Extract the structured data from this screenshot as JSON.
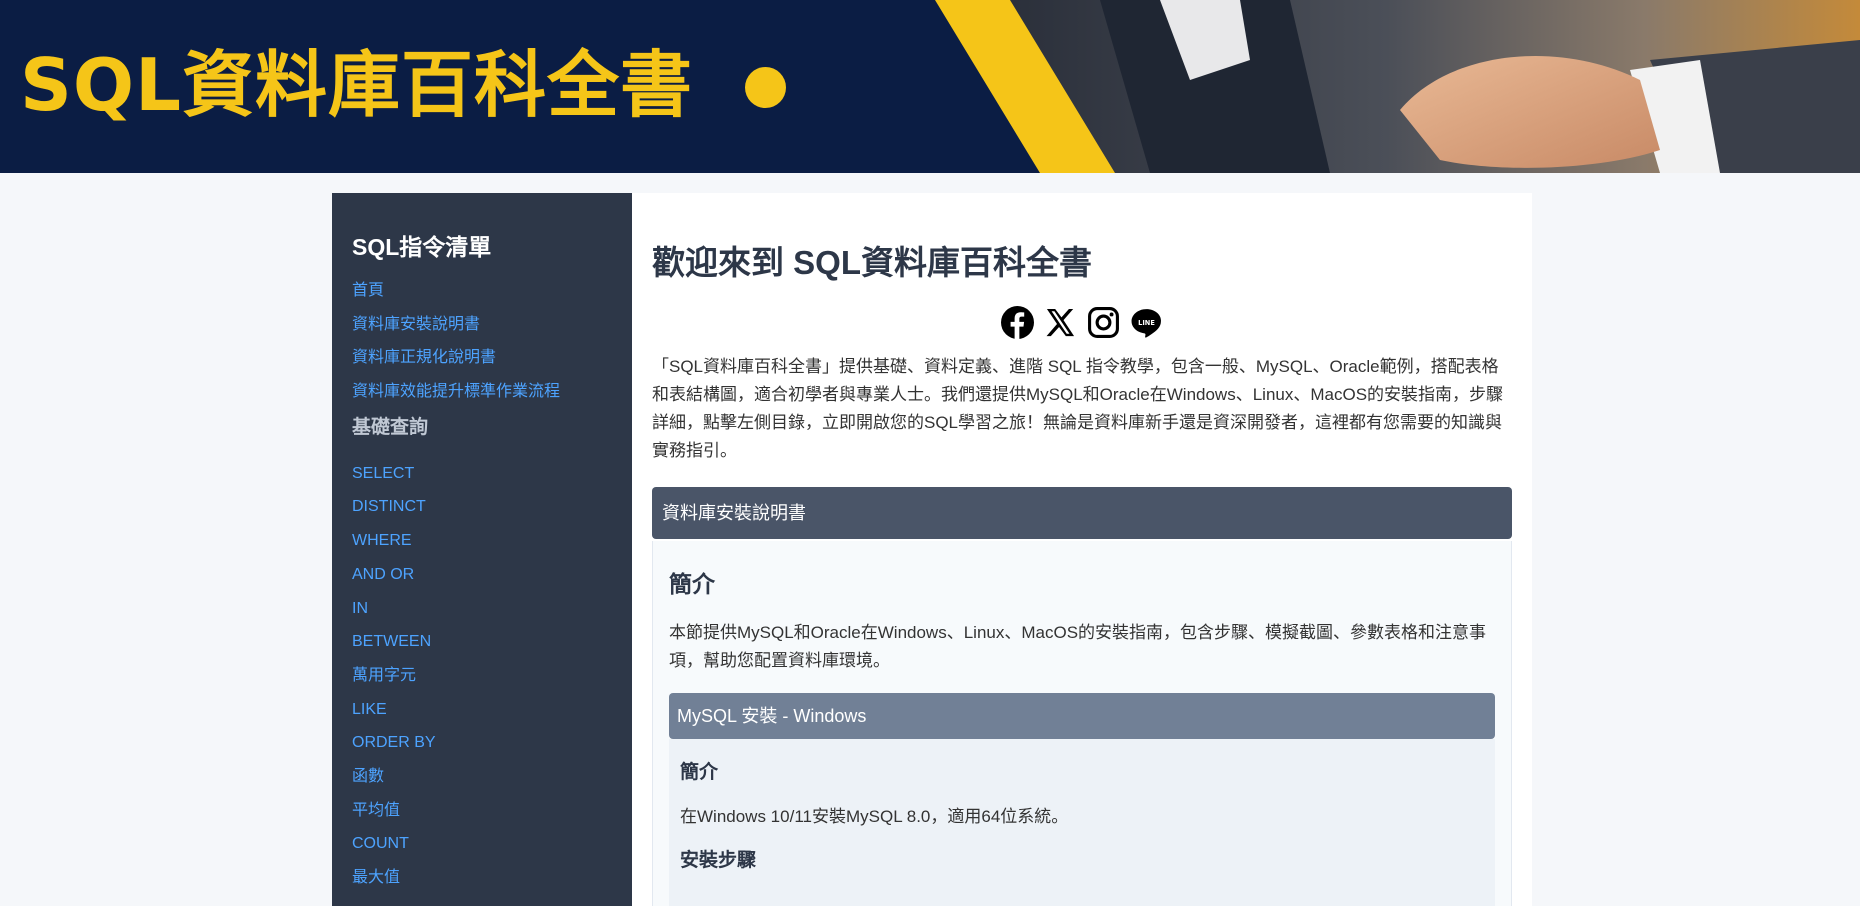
{
  "banner": {
    "title": "SQL資料庫百科全書",
    "colors": {
      "background": "#0b1d44",
      "accent": "#f5c518"
    }
  },
  "sidebar": {
    "title": "SQL指令清單",
    "top_links": [
      "首頁",
      "資料庫安裝說明書",
      "資料庫正規化說明書",
      "資料庫效能提升標準作業流程"
    ],
    "section_basic": "基礎查詢",
    "basic_links": [
      "SELECT",
      "DISTINCT",
      "WHERE",
      "AND OR",
      "IN",
      "BETWEEN",
      "萬用字元",
      "LIKE",
      "ORDER BY",
      "函數",
      "平均值",
      "COUNT",
      "最大值"
    ]
  },
  "main": {
    "title": "歡迎來到 SQL資料庫百科全書",
    "social_icons": [
      "facebook-icon",
      "x-icon",
      "instagram-icon",
      "line-icon"
    ],
    "intro": "「SQL資料庫百科全書」提供基礎、資料定義、進階 SQL 指令教學，包含一般、MySQL、Oracle範例，搭配表格和表結構圖，適合初學者與專業人士。我們還提供MySQL和Oracle在Windows、Linux、MacOS的安裝指南，步驟詳細，點擊左側目錄，立即開啟您的SQL學習之旅！無論是資料庫新手還是資深開發者，這裡都有您需要的知識與實務指引。",
    "panel": {
      "header": "資料庫安裝說明書",
      "heading": "簡介",
      "description": "本節提供MySQL和Oracle在Windows、Linux、MacOS的安裝指南，包含步驟、模擬截圖、參數表格和注意事項，幫助您配置資料庫環境。",
      "subsection": {
        "header": "MySQL 安裝 - Windows",
        "heading": "簡介",
        "text": "在Windows 10/11安裝MySQL 8.0，適用64位系統。",
        "steps_heading": "安裝步驟"
      }
    }
  }
}
